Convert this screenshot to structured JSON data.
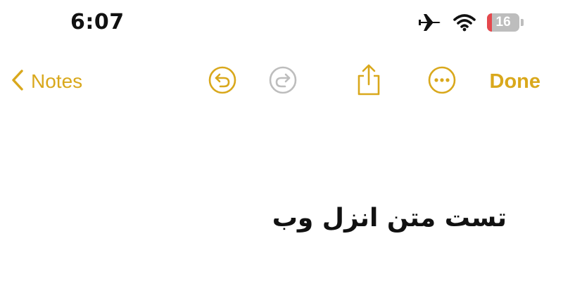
{
  "status_bar": {
    "time": "6:07",
    "battery_level": "16",
    "battery_fraction": 0.16,
    "icons": [
      "airplane-icon",
      "wifi-icon",
      "battery-icon"
    ]
  },
  "toolbar": {
    "back_label": "Notes",
    "done_label": "Done",
    "buttons": [
      "undo-icon",
      "redo-icon",
      "share-icon",
      "more-icon"
    ]
  },
  "note": {
    "text": "تست متن  انزل وب"
  },
  "colors": {
    "accent": "#d9a81c",
    "disabled": "#bdbdbd",
    "text": "#111111",
    "battery_low": "#e5484d"
  }
}
